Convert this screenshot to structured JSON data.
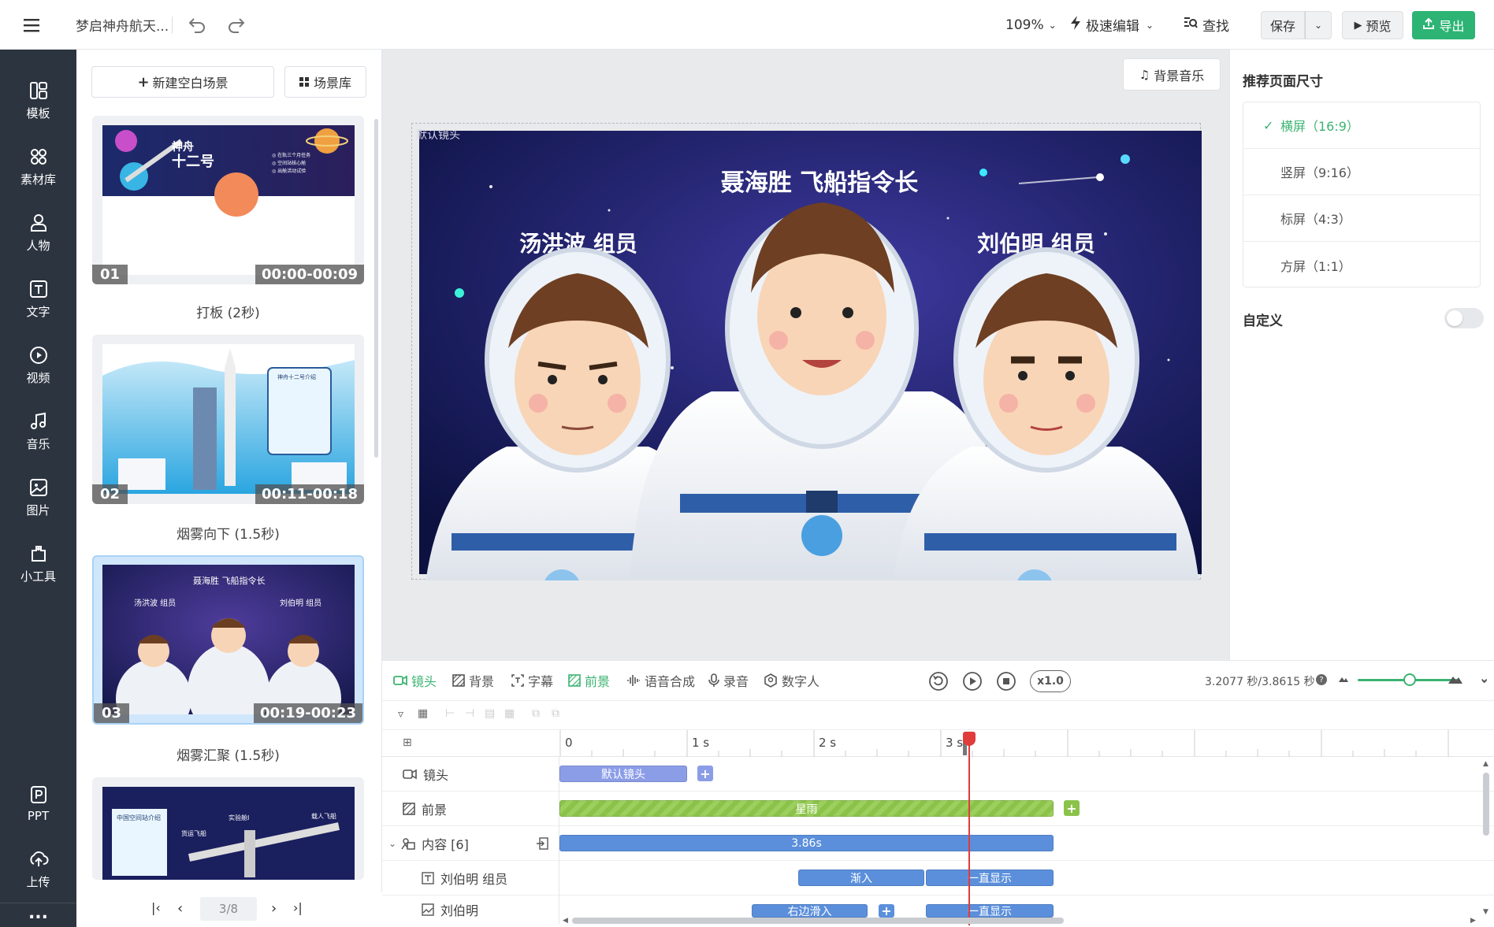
{
  "topbar": {
    "title": "梦启神舟航天...",
    "zoom": "109%",
    "mode": "极速编辑",
    "find": "查找",
    "save": "保存",
    "preview": "预览",
    "export": "导出"
  },
  "nav": {
    "items": [
      {
        "label": "模板",
        "icon": "template-icon"
      },
      {
        "label": "素材库",
        "icon": "library-icon"
      },
      {
        "label": "人物",
        "icon": "person-icon"
      },
      {
        "label": "文字",
        "icon": "text-icon"
      },
      {
        "label": "视频",
        "icon": "video-icon"
      },
      {
        "label": "音乐",
        "icon": "music-icon"
      },
      {
        "label": "图片",
        "icon": "image-icon"
      },
      {
        "label": "小工具",
        "icon": "tools-icon"
      }
    ],
    "bottom": [
      {
        "label": "PPT",
        "icon": "ppt-icon"
      },
      {
        "label": "上传",
        "icon": "upload-icon"
      }
    ],
    "more": "..."
  },
  "scenes": {
    "new_blank": "新建空白场景",
    "library": "场景库",
    "items": [
      {
        "num": "01",
        "time": "00:00-00:09",
        "label": "打板 (2秒)"
      },
      {
        "num": "02",
        "time": "00:11-00:18",
        "label": "烟雾向下 (1.5秒)"
      },
      {
        "num": "03",
        "time": "00:19-00:23",
        "label": "烟雾汇聚 (1.5秒)"
      }
    ],
    "pager": "3/8"
  },
  "stage": {
    "bg_music": "背景音乐",
    "camera_label": "默认镜头",
    "title_main": "聂海胜 飞船指令长",
    "title_left": "汤洪波 组员",
    "title_right": "刘伯明 组员"
  },
  "right": {
    "heading": "推荐页面尺寸",
    "options": [
      "横屏（16:9）",
      "竖屏（9:16）",
      "标屏（4:3）",
      "方屏（1:1）"
    ],
    "selected": 0,
    "custom": "自定义",
    "custom_on": false
  },
  "timeline": {
    "tabs": [
      {
        "label": "镜头",
        "icon": "camera-icon",
        "active": true
      },
      {
        "label": "背景",
        "icon": "background-icon",
        "active": false
      },
      {
        "label": "字幕",
        "icon": "subtitle-icon",
        "active": false
      },
      {
        "label": "前景",
        "icon": "foreground-icon",
        "active": true
      },
      {
        "label": "语音合成",
        "icon": "tts-icon",
        "active": false
      },
      {
        "label": "录音",
        "icon": "mic-icon",
        "active": false
      },
      {
        "label": "数字人",
        "icon": "avatar-icon",
        "active": false
      }
    ],
    "speed": "x1.0",
    "time_readout": "3.2077 秒/3.8615 秒",
    "ruler": [
      "0",
      "1 s",
      "2 s",
      "3 s"
    ],
    "tracks": [
      {
        "label": "镜头",
        "clips": [
          {
            "text": "默认镜头"
          }
        ]
      },
      {
        "label": "前景",
        "clips": [
          {
            "text": "星雨"
          }
        ]
      },
      {
        "label": "内容 [6]",
        "clips": [
          {
            "text": "3.86s"
          }
        ]
      },
      {
        "label": "刘伯明 组员",
        "clips": [
          {
            "text": "渐入"
          },
          {
            "text": "一直显示"
          }
        ]
      },
      {
        "label": "刘伯明",
        "clips": [
          {
            "text": "右边滑入"
          },
          {
            "text": "一直显示"
          }
        ]
      }
    ]
  },
  "colors": {
    "accent": "#3cb371",
    "export_green": "#2db474",
    "clip_blue": "#5b8fdb",
    "clip_green": "#8bc34a",
    "playhead": "#e03c3c",
    "nav_bg": "#2c3440"
  }
}
